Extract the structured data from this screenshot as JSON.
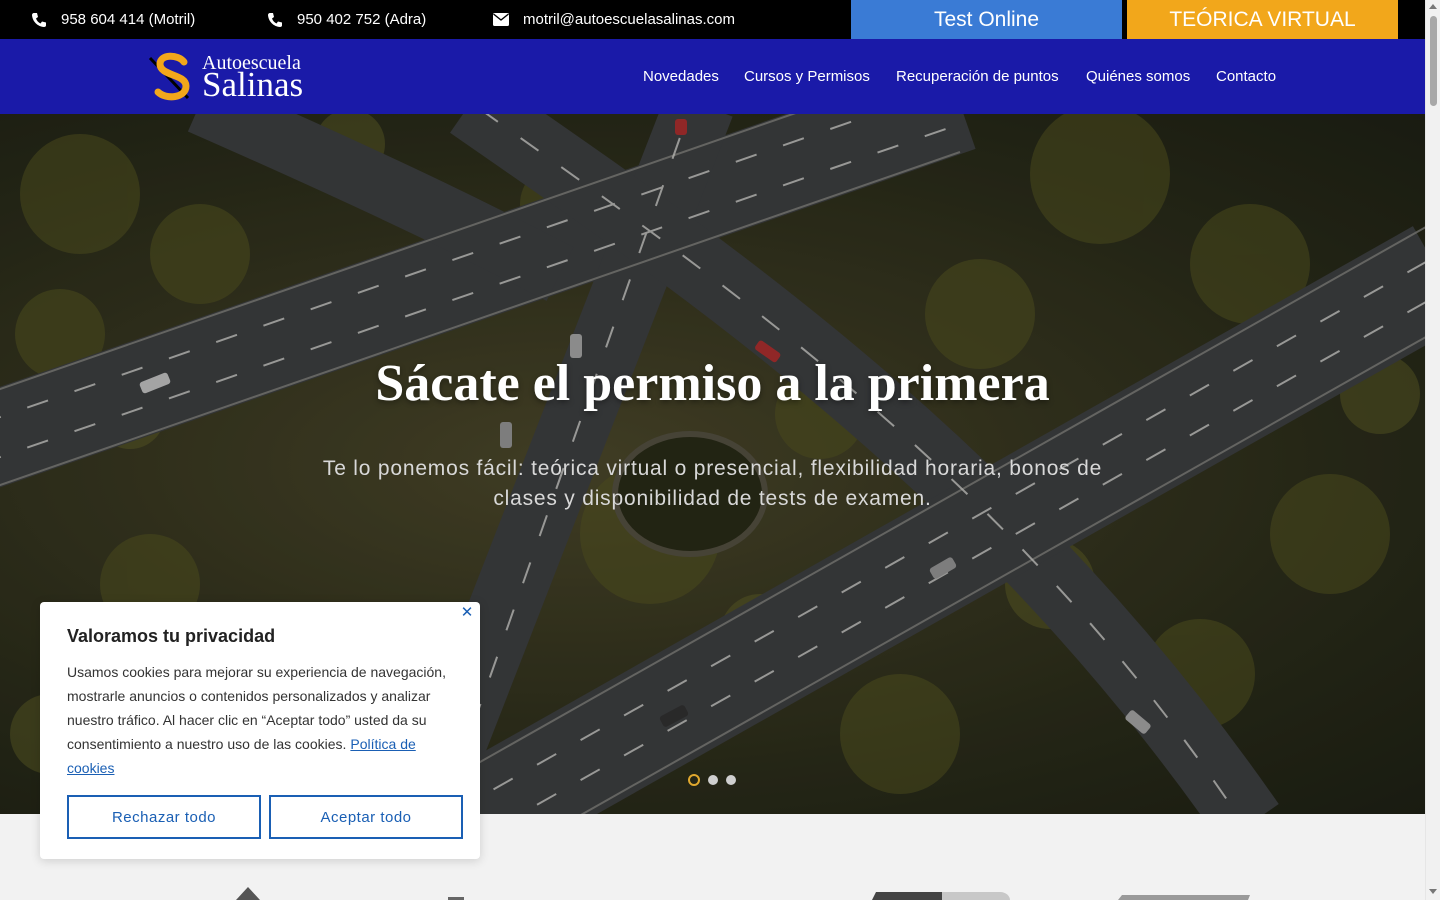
{
  "topbar": {
    "phone_motril": "958 604 414 (Motril)",
    "phone_adra": "950 402 752 (Adra)",
    "email": "motril@autoescuelasalinas.com",
    "test_online": "Test Online",
    "teorica_virtual": "TEÓRICA VIRTUAL"
  },
  "logo": {
    "top": "Autoescuela",
    "main": "Salinas"
  },
  "nav": {
    "items": [
      "Novedades",
      "Cursos y Permisos",
      "Recuperación de puntos",
      "Quiénes somos",
      "Contacto"
    ]
  },
  "hero": {
    "title": "Sácate el permiso a la primera",
    "subtitle": "Te lo ponemos fácil: teórica virtual o presencial, flexibilidad horaria, bonos de clases y disponibilidad de tests de examen."
  },
  "cookie": {
    "title": "Valoramos tu privacidad",
    "text": "Usamos cookies para mejorar su experiencia de navegación, mostrarle anuncios o contenidos personalizados y analizar nuestro tráfico. Al hacer clic en “Aceptar todo” usted da su consentimiento a nuestro uso de las cookies.",
    "link": "Política de cookies",
    "reject": "Rechazar todo",
    "accept": "Aceptar todo",
    "close": "✕"
  },
  "colors": {
    "header_blue": "#1a1aa8",
    "test_online_blue": "#3a7bd5",
    "teorica_orange": "#f2a71b",
    "link_blue": "#1a5fb4"
  }
}
